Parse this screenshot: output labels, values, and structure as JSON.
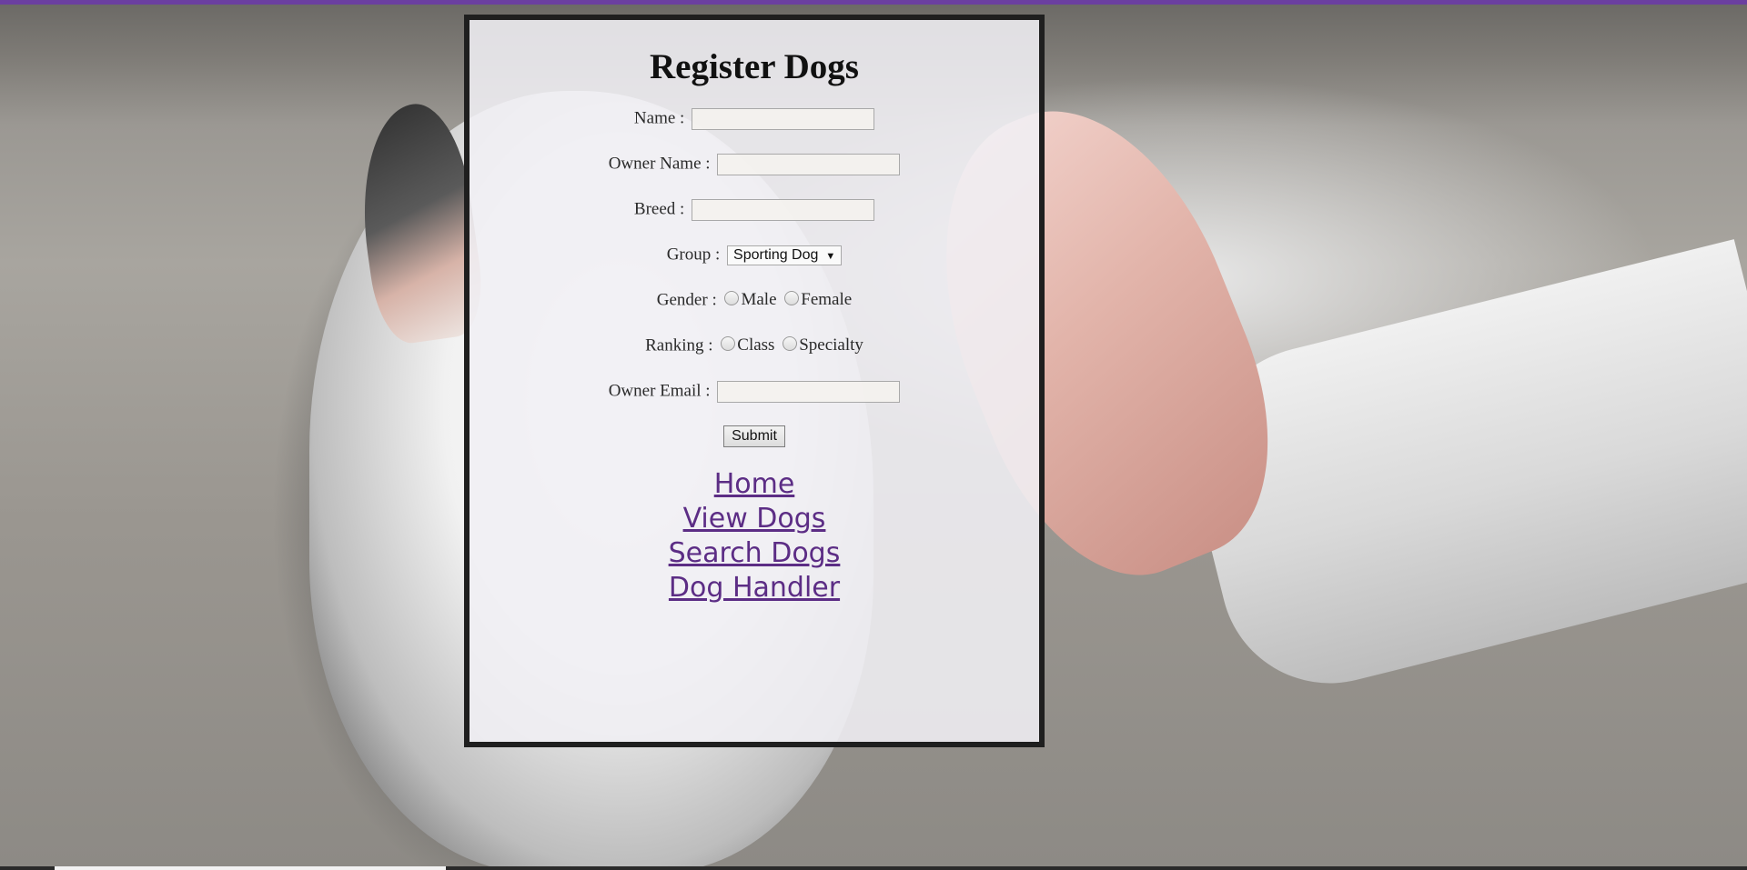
{
  "form": {
    "title": "Register Dogs",
    "fields": {
      "name_label": "Name :",
      "name_value": "",
      "owner_name_label": "Owner Name :",
      "owner_name_value": "",
      "breed_label": "Breed :",
      "breed_value": "",
      "group_label": "Group :",
      "group_selected": "Sporting Dog",
      "gender_label": "Gender :",
      "gender_options": [
        "Male",
        "Female"
      ],
      "ranking_label": "Ranking :",
      "ranking_options": [
        "Class",
        "Specialty"
      ],
      "owner_email_label": "Owner Email :",
      "owner_email_value": ""
    },
    "submit_label": "Submit"
  },
  "nav": {
    "links": [
      "Home",
      "View Dogs",
      "Search Dogs",
      "Dog Handler"
    ]
  },
  "colors": {
    "accent_bar": "#6b3fa0",
    "link": "#5c2d85",
    "panel_border": "#1f1f1f"
  },
  "icons": {
    "select_caret": "chevron-down-icon"
  }
}
